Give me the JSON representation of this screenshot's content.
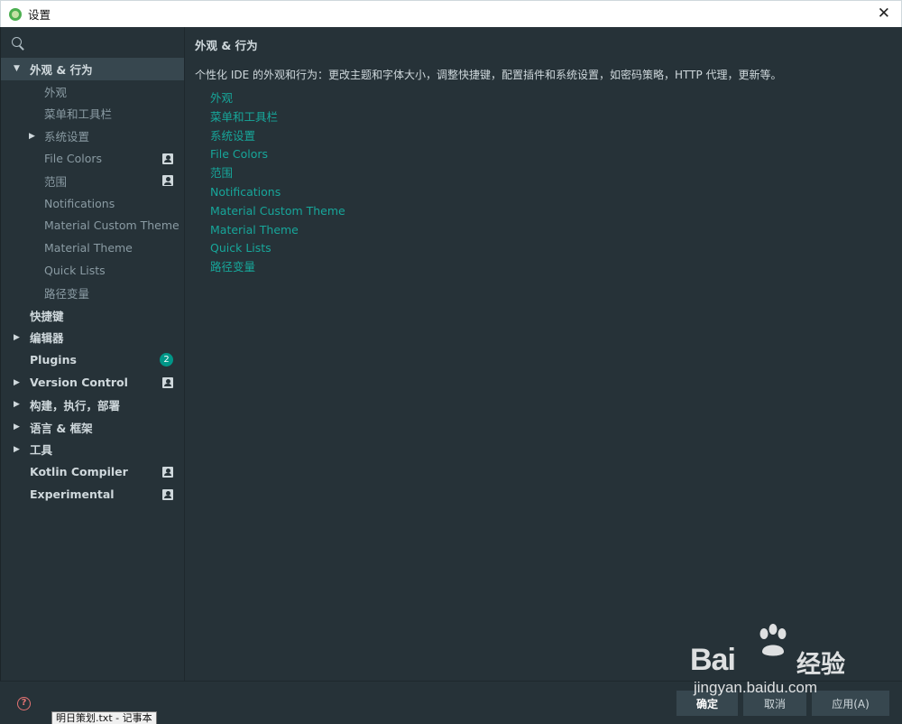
{
  "window": {
    "title": "设置",
    "close_symbol": "✕"
  },
  "search": {
    "placeholder": "",
    "value": ""
  },
  "sidebar": {
    "items": [
      {
        "label": "外观 & 行为",
        "level": 0,
        "arrow": "▼",
        "bold": true,
        "selected": true,
        "badge": null
      },
      {
        "label": "外观",
        "level": 1,
        "arrow": null,
        "bold": false,
        "selected": false,
        "badge": null
      },
      {
        "label": "菜单和工具栏",
        "level": 1,
        "arrow": null,
        "bold": false,
        "selected": false,
        "badge": null
      },
      {
        "label": "系统设置",
        "level": 1,
        "arrow": "▶",
        "bold": false,
        "selected": false,
        "badge": null
      },
      {
        "label": "File Colors",
        "level": 1,
        "arrow": null,
        "bold": false,
        "selected": false,
        "badge": "user-icon"
      },
      {
        "label": "范围",
        "level": 1,
        "arrow": null,
        "bold": false,
        "selected": false,
        "badge": "user-icon"
      },
      {
        "label": "Notifications",
        "level": 1,
        "arrow": null,
        "bold": false,
        "selected": false,
        "badge": null
      },
      {
        "label": "Material Custom Theme",
        "level": 1,
        "arrow": null,
        "bold": false,
        "selected": false,
        "badge": null
      },
      {
        "label": "Material Theme",
        "level": 1,
        "arrow": null,
        "bold": false,
        "selected": false,
        "badge": null
      },
      {
        "label": "Quick Lists",
        "level": 1,
        "arrow": null,
        "bold": false,
        "selected": false,
        "badge": null
      },
      {
        "label": "路径变量",
        "level": 1,
        "arrow": null,
        "bold": false,
        "selected": false,
        "badge": null
      },
      {
        "label": "快捷键",
        "level": 0,
        "arrow": null,
        "bold": true,
        "selected": false,
        "badge": null
      },
      {
        "label": "编辑器",
        "level": 0,
        "arrow": "▶",
        "bold": true,
        "selected": false,
        "badge": null
      },
      {
        "label": "Plugins",
        "level": 0,
        "arrow": null,
        "bold": true,
        "selected": false,
        "badge": "2"
      },
      {
        "label": "Version Control",
        "level": 0,
        "arrow": "▶",
        "bold": true,
        "selected": false,
        "badge": "user-icon"
      },
      {
        "label": "构建，执行，部署",
        "level": 0,
        "arrow": "▶",
        "bold": true,
        "selected": false,
        "badge": null
      },
      {
        "label": "语言 & 框架",
        "level": 0,
        "arrow": "▶",
        "bold": true,
        "selected": false,
        "badge": null
      },
      {
        "label": "工具",
        "level": 0,
        "arrow": "▶",
        "bold": true,
        "selected": false,
        "badge": null
      },
      {
        "label": "Kotlin Compiler",
        "level": 0,
        "arrow": null,
        "bold": true,
        "selected": false,
        "badge": "user-icon"
      },
      {
        "label": "Experimental",
        "level": 0,
        "arrow": null,
        "bold": true,
        "selected": false,
        "badge": "user-icon"
      }
    ]
  },
  "main": {
    "title": "外观 & 行为",
    "description": "个性化 IDE 的外观和行为：更改主题和字体大小，调整快捷键，配置插件和系统设置，如密码策略，HTTP 代理，更新等。",
    "links": [
      "外观",
      "菜单和工具栏",
      "系统设置",
      "File Colors",
      "范围",
      "Notifications",
      "Material Custom Theme",
      "Material Theme",
      "Quick Lists",
      "路径变量"
    ]
  },
  "footer": {
    "help_symbol": "?",
    "ok_label": "确定",
    "cancel_label": "取消",
    "apply_label": "应用(A)",
    "taskbar_tooltip": "明日策划.txt - 记事本"
  },
  "watermark": {
    "brand": "Bai",
    "brand_cn": "经验",
    "url": "jingyan.baidu.com"
  },
  "colors": {
    "background": "#263238",
    "selected": "#37474f",
    "accent": "#009688",
    "link": "#17a69a",
    "text": "#cfd8dc"
  }
}
